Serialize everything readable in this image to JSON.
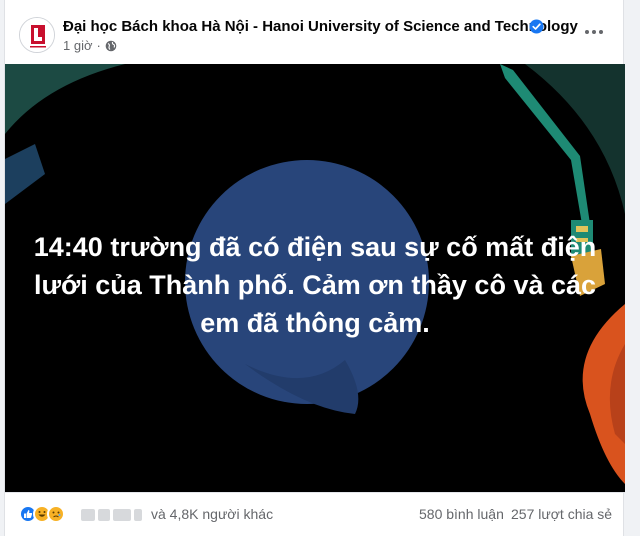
{
  "post": {
    "page_name": "Đại học Bách khoa Hà Nội - Hanoi University of Science and Technology",
    "verified_icon": "verified-badge-icon",
    "time": "1 giờ",
    "separator": "·",
    "privacy_icon": "globe-icon",
    "more_icon": "more-options-icon"
  },
  "media": {
    "text": "14:40 trường đã có điện sau sự cố mất điện lưới của Thành phố. Cảm ơn thầy cô và các em đã thông cảm.",
    "colors": {
      "background": "#000000",
      "circle": "#28457a",
      "teal": "#1e8a74",
      "orange": "#d9531e",
      "dark_green": "#1c4a43"
    }
  },
  "footer": {
    "reactions": [
      "like-icon",
      "haha-icon",
      "sad-icon"
    ],
    "others": "và 4,8K người khác",
    "comments": "580 bình luận",
    "shares": "257 lượt chia sẻ"
  },
  "colors": {
    "accent": "#1877f2",
    "secondary_text": "#65676b",
    "primary_text": "#050505"
  }
}
